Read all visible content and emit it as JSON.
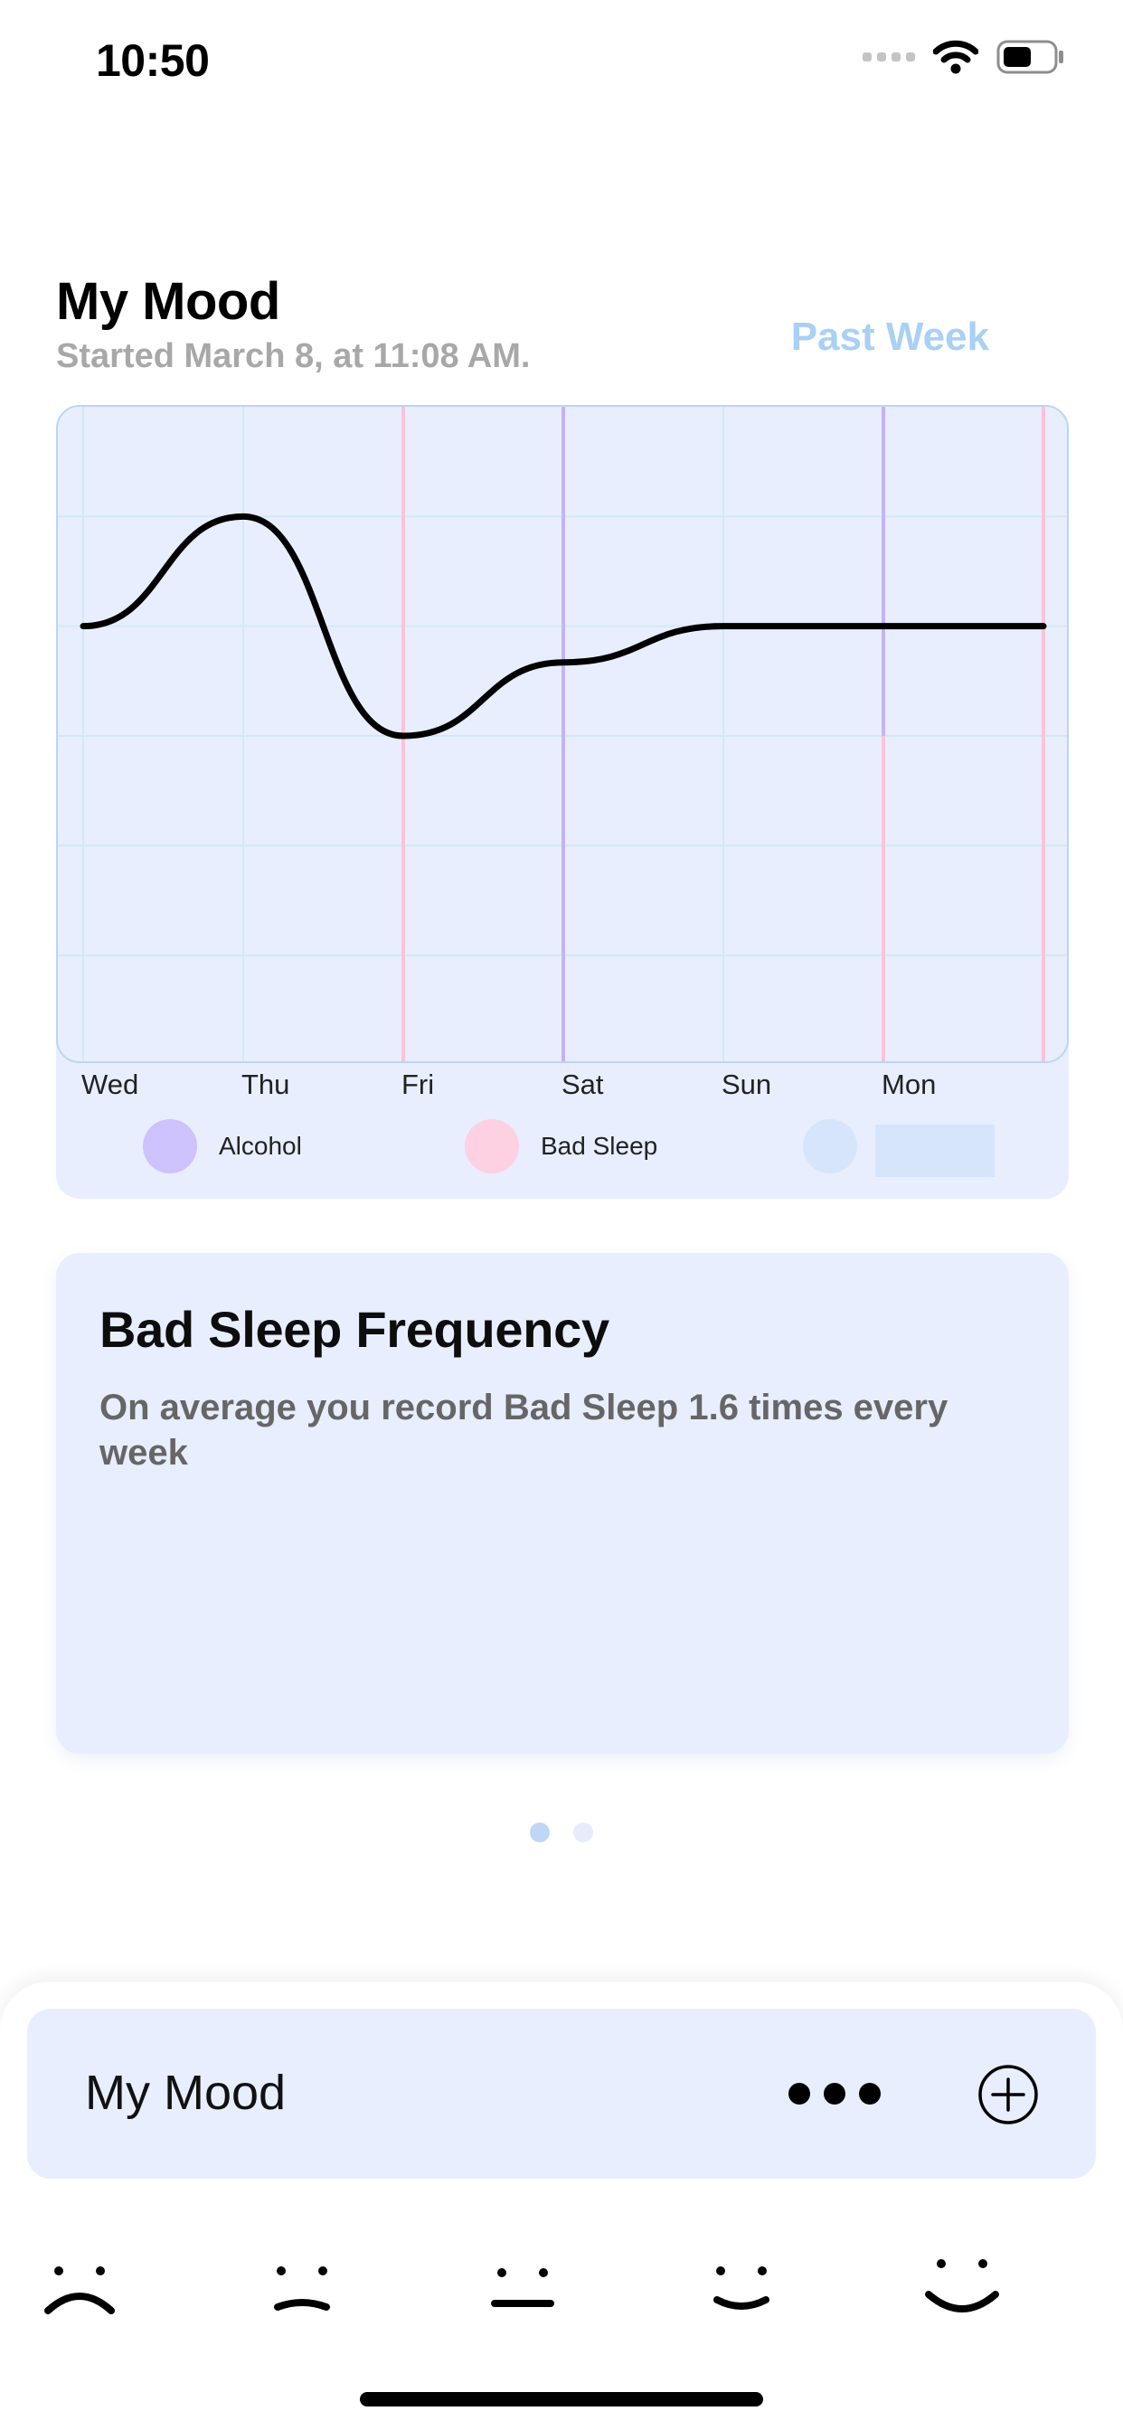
{
  "status_bar": {
    "time": "10:50"
  },
  "header": {
    "title": "My Mood",
    "subtitle": "Started March 8, at 11:08 AM.",
    "range_button": "Past Week"
  },
  "chart_data": {
    "type": "line",
    "categories": [
      "Wed",
      "Thu",
      "Fri",
      "Sat",
      "Sun",
      "Mon",
      ""
    ],
    "series": [
      {
        "values": [
          4,
          5,
          3,
          3.67,
          4,
          4,
          4
        ],
        "color": "#000000"
      }
    ],
    "ylim": [
      0,
      6
    ],
    "grid": true,
    "events": [
      {
        "label": "Bad Sleep",
        "x_index": 2
      },
      {
        "label": "Alcohol",
        "x_index": 3
      },
      {
        "label": "Alcohol",
        "x_index": 5
      },
      {
        "label": "Bad Sleep",
        "x_index": 5
      },
      {
        "label": "Bad Sleep",
        "x_index": 6
      }
    ],
    "legend": [
      {
        "label": "Alcohol",
        "color": "#cdc2fb"
      },
      {
        "label": "Bad Sleep",
        "color": "#fdd0e2"
      },
      {
        "label": "",
        "color": "#d6e5fb"
      }
    ],
    "colors": {
      "alcohol_line": "#c4b4f5",
      "bad_sleep_line": "#fcc3d8",
      "grid": "#d3e8f6"
    }
  },
  "frequency_card": {
    "title": "Bad Sleep Frequency",
    "text": "On average you record Bad Sleep 1.6 times every week"
  },
  "pagination": {
    "pages": 2,
    "active": 0,
    "active_color": "#bfd6f6",
    "inactive_color": "#e5edfb"
  },
  "bottom_bar": {
    "title": "My Mood",
    "more_icon": "more-dots-icon",
    "add_icon": "plus-circle-icon"
  },
  "moods": [
    {
      "icon": "very-sad-face-icon"
    },
    {
      "icon": "sad-face-icon"
    },
    {
      "icon": "neutral-face-icon"
    },
    {
      "icon": "happy-face-icon"
    },
    {
      "icon": "very-happy-face-icon"
    }
  ],
  "theme": {
    "card_bg": "#e8eefd",
    "accent": "#a9d0f5"
  }
}
